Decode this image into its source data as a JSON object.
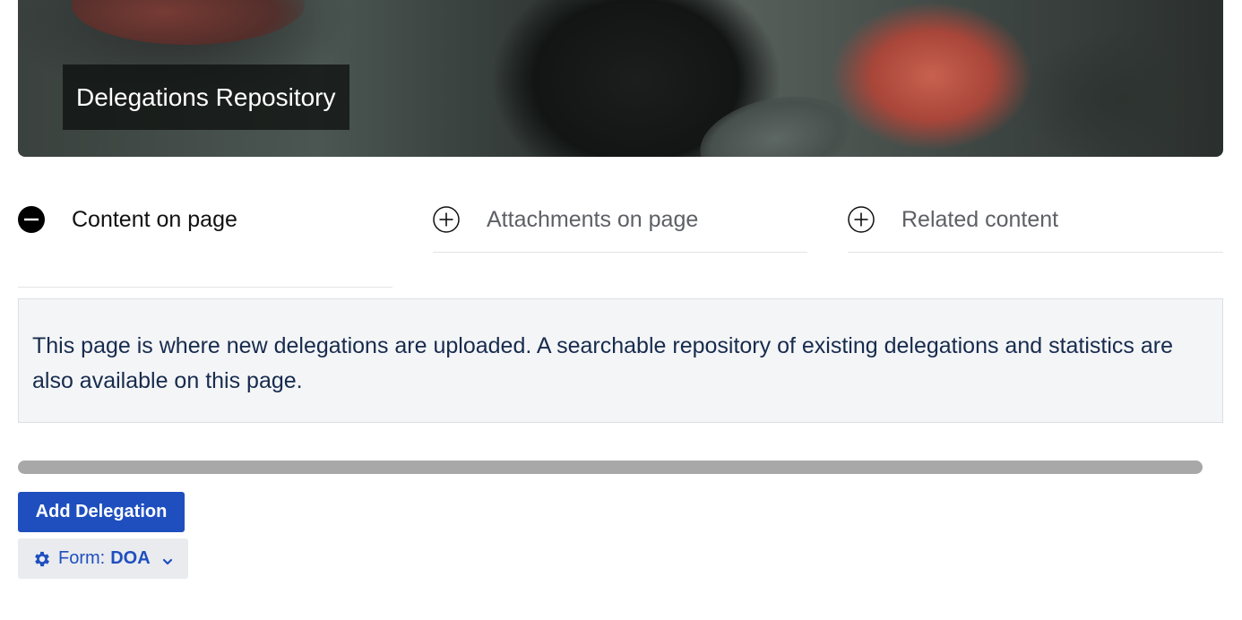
{
  "banner": {
    "title": "Delegations Repository"
  },
  "tabs": [
    {
      "label": "Content on page",
      "state": "expanded",
      "icon": "minus-circle-icon"
    },
    {
      "label": "Attachments on page",
      "state": "collapsed",
      "icon": "plus-circle-icon"
    },
    {
      "label": "Related content",
      "state": "collapsed",
      "icon": "plus-circle-icon"
    }
  ],
  "info_panel": {
    "text": "This page is where new delegations are uploaded. A searchable repository of existing delegations and statistics are also available on this page."
  },
  "actions": {
    "add_delegation_label": "Add Delegation",
    "form_label": "Form:",
    "form_value": "DOA",
    "form_icon": "gear-icon",
    "form_dropdown_icon": "chevron-down-icon"
  },
  "colors": {
    "primary_button": "#1f4fbf",
    "panel_background": "#f4f5f7",
    "scrollbar_thumb": "#a8a8a8",
    "text_primary": "#172b4d"
  }
}
